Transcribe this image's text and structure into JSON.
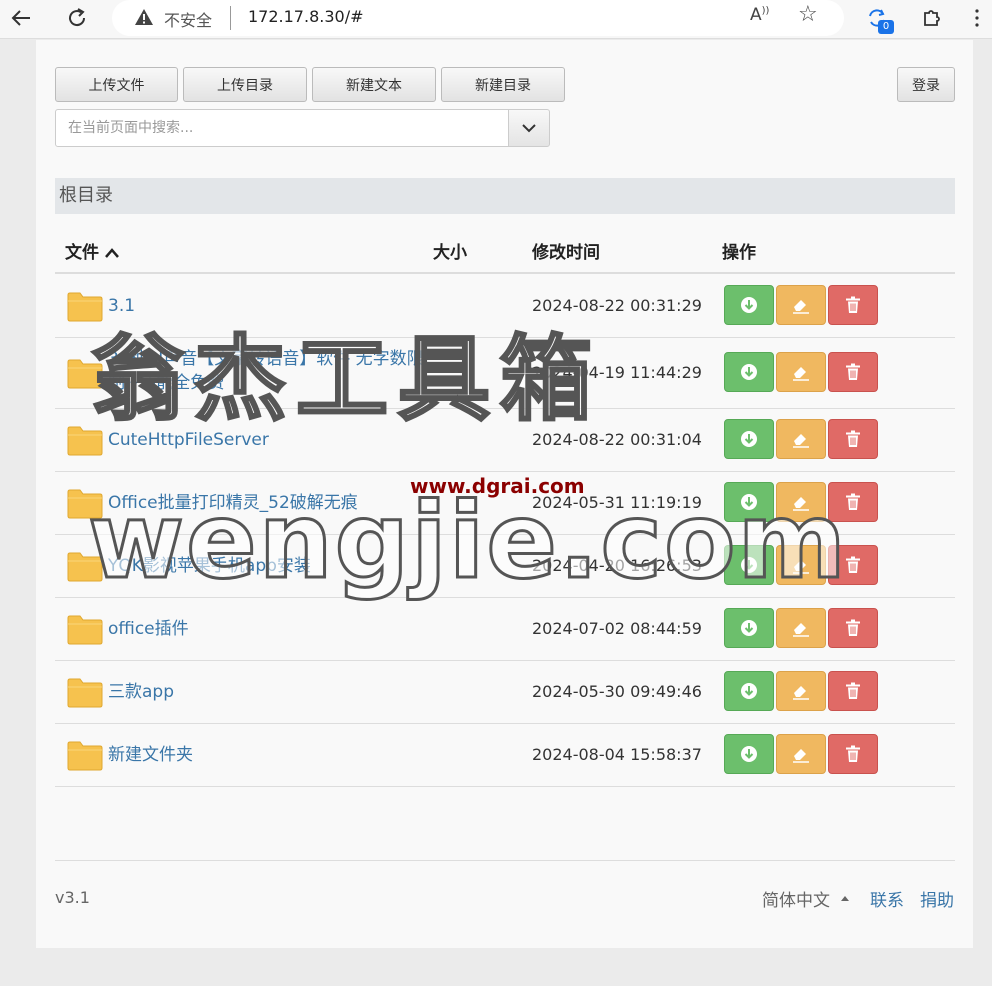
{
  "browser": {
    "security_text": "不安全",
    "url": "172.17.8.30/#",
    "sync_badge": "0"
  },
  "toolbar": {
    "upload_file": "上传文件",
    "upload_dir": "上传目录",
    "new_text": "新建文本",
    "new_dir": "新建目录",
    "login": "登录"
  },
  "search": {
    "placeholder": "在当前页面中搜索..."
  },
  "breadcrumb": "根目录",
  "table": {
    "headers": {
      "file": "文件",
      "size": "大小",
      "modified": "修改时间",
      "actions": "操作"
    },
    "rows": [
      {
        "name": "3.1",
        "size": "",
        "modified": "2024-08-22 00:31:29"
      },
      {
        "name": "34种AI声音【文字转语音】软件 无字数限制~功能全免费",
        "size": "",
        "modified": "2024-04-19 11:44:29"
      },
      {
        "name": "CuteHttpFileServer",
        "size": "",
        "modified": "2024-08-22 00:31:04"
      },
      {
        "name": "Office批量打印精灵_52破解无痕",
        "size": "",
        "modified": "2024-05-31 11:19:19"
      },
      {
        "name": "YQK影视苹果手机app安装",
        "size": "",
        "modified": "2024-04-20 16:26:53"
      },
      {
        "name": "office插件",
        "size": "",
        "modified": "2024-07-02 08:44:59"
      },
      {
        "name": "三款app",
        "size": "",
        "modified": "2024-05-30 09:49:46"
      },
      {
        "name": "新建文件夹",
        "size": "",
        "modified": "2024-08-04 15:58:37"
      }
    ]
  },
  "footer": {
    "version": "v3.1",
    "language": "简体中文",
    "contact": "联系",
    "donate": "捐助"
  },
  "watermark": {
    "line1": "翁杰工具箱",
    "line2": "www.dgrai.com",
    "line3": "wengjie.com"
  },
  "colors": {
    "link": "#3a76a8",
    "download": "#6cbf6c",
    "edit": "#f0b860",
    "delete": "#e06a66",
    "folder": "#f6c24e"
  }
}
